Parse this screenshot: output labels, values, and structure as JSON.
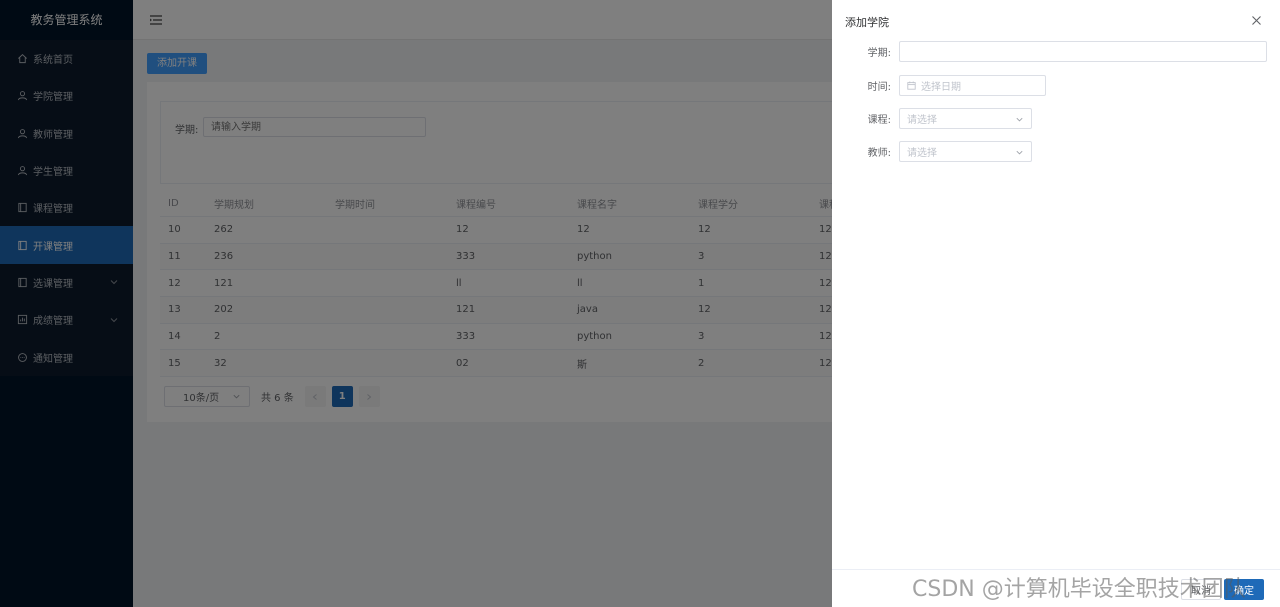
{
  "app": {
    "title": "教务管理系统"
  },
  "sidebar": {
    "items": [
      {
        "label": "系统首页",
        "icon": "home-icon",
        "active": false,
        "expandable": false
      },
      {
        "label": "学院管理",
        "icon": "user-icon",
        "active": false,
        "expandable": false
      },
      {
        "label": "教师管理",
        "icon": "user-icon",
        "active": false,
        "expandable": false
      },
      {
        "label": "学生管理",
        "icon": "user-icon",
        "active": false,
        "expandable": false
      },
      {
        "label": "课程管理",
        "icon": "book-icon",
        "active": false,
        "expandable": false
      },
      {
        "label": "开课管理",
        "icon": "book-icon",
        "active": true,
        "expandable": false
      },
      {
        "label": "选课管理",
        "icon": "book-icon",
        "active": false,
        "expandable": true
      },
      {
        "label": "成绩管理",
        "icon": "chart-icon",
        "active": false,
        "expandable": true
      },
      {
        "label": "通知管理",
        "icon": "chat-icon",
        "active": false,
        "expandable": false
      }
    ]
  },
  "toolbar": {
    "add_label": "添加开课"
  },
  "search": {
    "label": "学期:",
    "placeholder": "请输入学期"
  },
  "table": {
    "headers": [
      "ID",
      "学期规划",
      "学期时间",
      "课程编号",
      "课程名字",
      "课程学分",
      "课程"
    ],
    "rows": [
      [
        "10",
        "262",
        "",
        "12",
        "12",
        "12",
        "12"
      ],
      [
        "11",
        "236",
        "",
        "333",
        "python",
        "3",
        "12"
      ],
      [
        "12",
        "121",
        "",
        "ll",
        "ll",
        "1",
        "12"
      ],
      [
        "13",
        "202",
        "",
        "121",
        "java",
        "12",
        "12"
      ],
      [
        "14",
        "2",
        "",
        "333",
        "python",
        "3",
        "12"
      ],
      [
        "15",
        "32",
        "",
        "02",
        "斯",
        "2",
        "12"
      ]
    ]
  },
  "pagination": {
    "page_size": "10条/页",
    "total": "共 6 条",
    "current": "1"
  },
  "drawer": {
    "title": "添加学院",
    "fields": {
      "term": {
        "label": "学期:",
        "value": ""
      },
      "time": {
        "label": "时间:",
        "placeholder": "选择日期"
      },
      "course": {
        "label": "课程:",
        "placeholder": "请选择"
      },
      "teacher": {
        "label": "教师:",
        "placeholder": "请选择"
      }
    },
    "cancel_label": "取消",
    "ok_label": "确定"
  },
  "watermark": "CSDN @计算机毕设全职技术团队",
  "colors": {
    "sidebar_bg": "#001529",
    "active": "#1e6ab8",
    "primary": "#409eff"
  }
}
